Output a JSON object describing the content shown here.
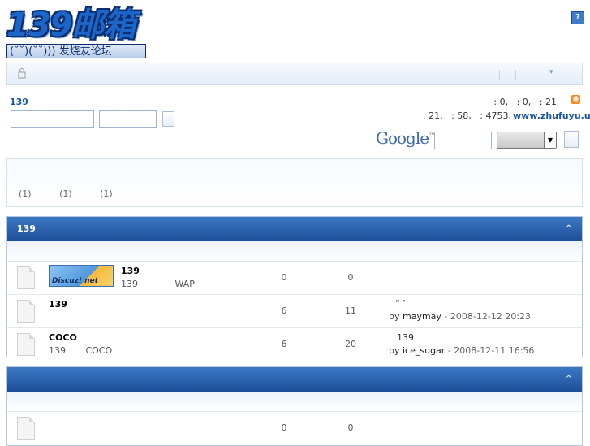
{
  "header": {
    "logo_main": "139邮箱",
    "logo_sub": "(˘˘)(˘˘))) 发烧友论坛",
    "help_icon": "?"
  },
  "userbar": {
    "menu_arrow": "▾"
  },
  "forum_info": {
    "title": "139",
    "stats_line1": ": 0,   : 0,   : 21",
    "stats_line2": ": 21,   : 58,   : 4753,",
    "site_link": "www.zhufuyu.us"
  },
  "google": {
    "logo": "Google",
    "tm": "™"
  },
  "notice": {
    "items": "(1)   (1)   (1)"
  },
  "categories": [
    {
      "title": "139",
      "collapse_icon": "^",
      "forums": [
        {
          "name": "139",
          "desc": "139             WAP",
          "threads": "0",
          "posts": "0",
          "last_title": "",
          "last_by": "",
          "last_user": "",
          "last_date": "",
          "has_logo": true,
          "logo_text": "Discuz! net"
        },
        {
          "name": "139",
          "desc": "",
          "threads": "6",
          "posts": "11",
          "last_title": "“ ’",
          "last_by": "by ",
          "last_user": "maymay",
          "last_date": " - 2008-12-12 20:23"
        },
        {
          "name": "COCO",
          "desc": "139       COCO",
          "threads": "6",
          "posts": "20",
          "last_title": "139",
          "last_by": "by ",
          "last_user": "ice_sugar",
          "last_date": " - 2008-12-11 16:56"
        }
      ]
    },
    {
      "title": "",
      "collapse_icon": "^",
      "forums": [
        {
          "name": "",
          "desc": "",
          "threads": "0",
          "posts": "0"
        }
      ]
    }
  ]
}
